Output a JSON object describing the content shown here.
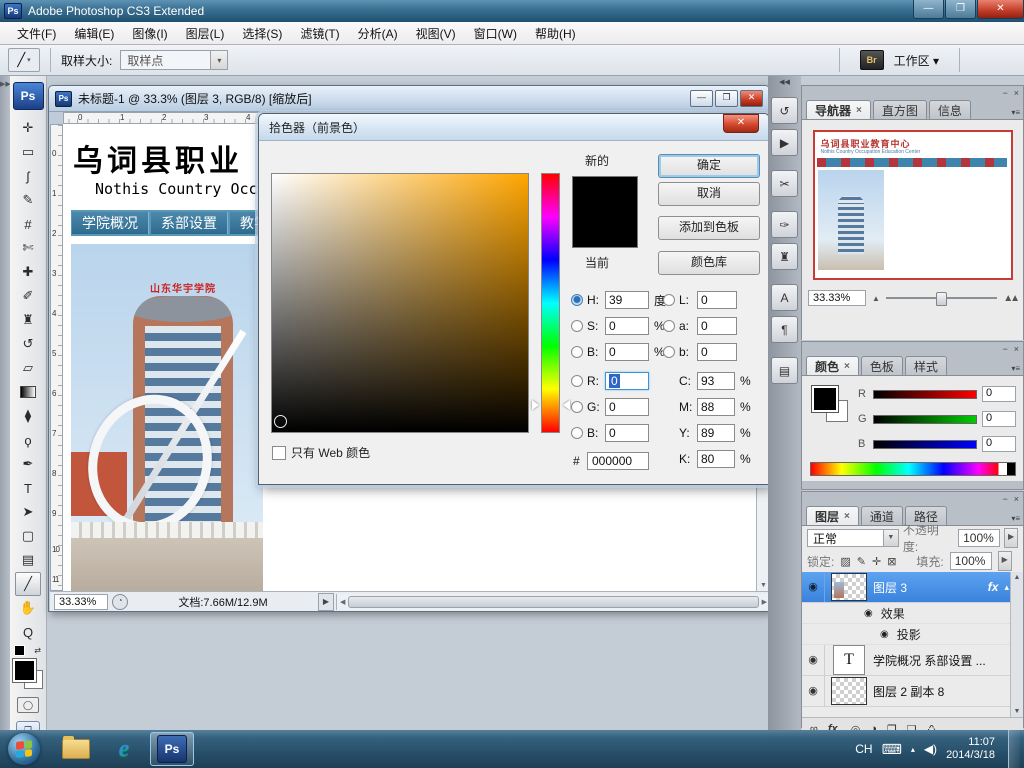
{
  "titlebar": {
    "app_badge": "Ps",
    "title": "Adobe Photoshop CS3 Extended",
    "minimize": "—",
    "maximize": "❐",
    "close": "✕"
  },
  "menubar": {
    "items": [
      "文件(F)",
      "编辑(E)",
      "图像(I)",
      "图层(L)",
      "选择(S)",
      "滤镜(T)",
      "分析(A)",
      "视图(V)",
      "窗口(W)",
      "帮助(H)"
    ]
  },
  "optionsbar": {
    "tool_glyph": "╱",
    "tool_arrow": "▾",
    "sample_size_label": "取样大小:",
    "sample_size_value": "取样点",
    "combo_arrow": "▾",
    "bridge_label": "Br",
    "workspace_label": "工作区 ▾"
  },
  "toolbar": {
    "logo": "Ps",
    "tools": [
      {
        "name": "move-tool",
        "glyph": "✛"
      },
      {
        "name": "marquee-tool",
        "glyph": "▭"
      },
      {
        "name": "lasso-tool",
        "glyph": "ʃ"
      },
      {
        "name": "quick-selection-tool",
        "glyph": "✎"
      },
      {
        "name": "crop-tool",
        "glyph": "#"
      },
      {
        "name": "slice-tool",
        "glyph": "✄"
      },
      {
        "name": "healing-brush-tool",
        "glyph": "✚"
      },
      {
        "name": "brush-tool",
        "glyph": "✐"
      },
      {
        "name": "clone-stamp-tool",
        "glyph": "♜"
      },
      {
        "name": "history-brush-tool",
        "glyph": "↺"
      },
      {
        "name": "eraser-tool",
        "glyph": "▱"
      },
      {
        "name": "gradient-tool",
        "glyph": ""
      },
      {
        "name": "blur-tool",
        "glyph": "⧫"
      },
      {
        "name": "dodge-tool",
        "glyph": "ϙ"
      },
      {
        "name": "pen-tool",
        "glyph": "✒"
      },
      {
        "name": "type-tool",
        "glyph": "T"
      },
      {
        "name": "path-selection-tool",
        "glyph": "➤"
      },
      {
        "name": "shape-tool",
        "glyph": "▢"
      },
      {
        "name": "notes-tool",
        "glyph": "▤"
      },
      {
        "name": "eyedropper-tool",
        "glyph": "╱"
      },
      {
        "name": "hand-tool",
        "glyph": "✋"
      },
      {
        "name": "zoom-tool",
        "glyph": "Q"
      }
    ],
    "swap_glyph": "⇄",
    "quick_mask_glyph": "◯",
    "screen_mode_glyph": "❐"
  },
  "doc": {
    "title": "未标题-1 @ 33.3% (图层 3, RGB/8) [缩放后]",
    "minimize": "—",
    "maximize": "❐",
    "close": "✕",
    "ruler_h": [
      "0",
      "1",
      "2",
      "3",
      "4"
    ],
    "ruler_v": [
      "0",
      "1",
      "2",
      "3",
      "4",
      "5",
      "6",
      "7",
      "8",
      "9",
      "10",
      "11"
    ],
    "status": {
      "zoom": "33.33%",
      "doc_size": "文档:7.66M/12.9M",
      "arrow": "▶",
      "scroll_left": "◀",
      "scroll_right": "▶",
      "scroll_up": "▲",
      "scroll_down": "▼"
    },
    "canvas": {
      "heading": "乌词县职业",
      "subtitle": "Nothis Country Occ",
      "nav": [
        "学院概况",
        "系部设置",
        "教学管理"
      ],
      "building_sign": "山东华宇学院"
    }
  },
  "picker": {
    "title": "拾色器（前景色）",
    "close": "✕",
    "new_label": "新的",
    "current_label": "当前",
    "ok": "确定",
    "cancel": "取消",
    "add_to_swatches": "添加到色板",
    "color_libraries": "颜色库",
    "h_label": "H:",
    "h_value": "39",
    "h_unit": "度",
    "s_label": "S:",
    "s_value": "0",
    "s_unit": "%",
    "b_label": "B:",
    "b_value": "0",
    "b_unit": "%",
    "r_label": "R:",
    "r_value": "0",
    "g_label": "G:",
    "g_value": "0",
    "b2_label": "B:",
    "b2_value": "0",
    "hex_label": "#",
    "hex_value": "000000",
    "l_label": "L:",
    "l_value": "0",
    "a_label": "a:",
    "a_value": "0",
    "lab_b_label": "b:",
    "lab_b_value": "0",
    "c_label": "C:",
    "c_value": "93",
    "c_unit": "%",
    "m_label": "M:",
    "m_value": "88",
    "m_unit": "%",
    "y_label": "Y:",
    "y_value": "89",
    "y_unit": "%",
    "k_label": "K:",
    "k_value": "80",
    "k_unit": "%",
    "web_only_label": "只有 Web 颜色"
  },
  "dock": {
    "collapse_glyph": "◀◀",
    "expand_glyph": "▶▶",
    "icons": [
      {
        "name": "history-panel",
        "glyph": "↺"
      },
      {
        "name": "actions-panel",
        "glyph": "▶"
      },
      {
        "name": "tool-presets-panel",
        "glyph": "✂"
      },
      {
        "name": "brushes-panel",
        "glyph": "✑"
      },
      {
        "name": "clone-source-panel",
        "glyph": "♜"
      },
      {
        "name": "character-panel",
        "glyph": "A"
      },
      {
        "name": "paragraph-panel",
        "glyph": "¶"
      },
      {
        "name": "layer-comps-panel",
        "glyph": "▤"
      }
    ]
  },
  "panels": {
    "minimize": "−",
    "close": "×",
    "menu": "▾≡",
    "tab_close": "×",
    "navigator": {
      "tabs": [
        "导航器",
        "直方图",
        "信息"
      ],
      "thumb_title": "乌词县职业教育中心",
      "thumb_subtitle": "Nothis Country Occupation Education Center",
      "zoom": "33.33%",
      "zoom_out": "▲",
      "zoom_in": "▲▲"
    },
    "color": {
      "tabs": [
        "颜色",
        "色板",
        "样式"
      ],
      "r_label": "R",
      "g_label": "G",
      "b_label": "B",
      "r_value": "0",
      "g_value": "0",
      "b_value": "0"
    },
    "layers": {
      "tabs": [
        "图层",
        "通道",
        "路径"
      ],
      "blend_mode": "正常",
      "opacity_label": "不透明度:",
      "opacity_value": "100%",
      "lock_label": "锁定:",
      "fill_label": "填充:",
      "fill_value": "100%",
      "eye": "◉",
      "layer3_label": "图层 3",
      "fx_badge": "fx",
      "collapse_arrow": "▴",
      "effects_label": "效果",
      "shadow_label": "投影",
      "text_layer_thumb": "T",
      "text_layer_label": "学院概况 系部设置 ...",
      "layer2_label": "图层 2 副本 8",
      "foot_icons": [
        {
          "name": "link-layers-icon",
          "glyph": "∞"
        },
        {
          "name": "layer-style-icon",
          "glyph": "fx."
        },
        {
          "name": "add-mask-icon",
          "glyph": "◎"
        },
        {
          "name": "adjustment-layer-icon",
          "glyph": "◑"
        },
        {
          "name": "new-group-icon",
          "glyph": "❒"
        },
        {
          "name": "new-layer-icon",
          "glyph": "❏"
        },
        {
          "name": "delete-layer-icon",
          "glyph": "♺"
        }
      ],
      "lock_icons": [
        {
          "name": "lock-transparency-icon",
          "glyph": "▨"
        },
        {
          "name": "lock-paint-icon",
          "glyph": "✎"
        },
        {
          "name": "lock-move-icon",
          "glyph": "✛"
        },
        {
          "name": "lock-all-icon",
          "glyph": "⊠"
        }
      ]
    }
  },
  "taskbar": {
    "ie_label": "e",
    "ps_label": "Ps",
    "lang": "CH",
    "keyboard_glyph": "⌨",
    "tray_arrow": "▴",
    "speaker_glyph": "◀)",
    "time": "11:07",
    "date": "2014/3/18"
  },
  "colors": {
    "selection_blue": "#3a82dd",
    "hue_degrees": 39,
    "view_box_red": "#c83a36"
  }
}
